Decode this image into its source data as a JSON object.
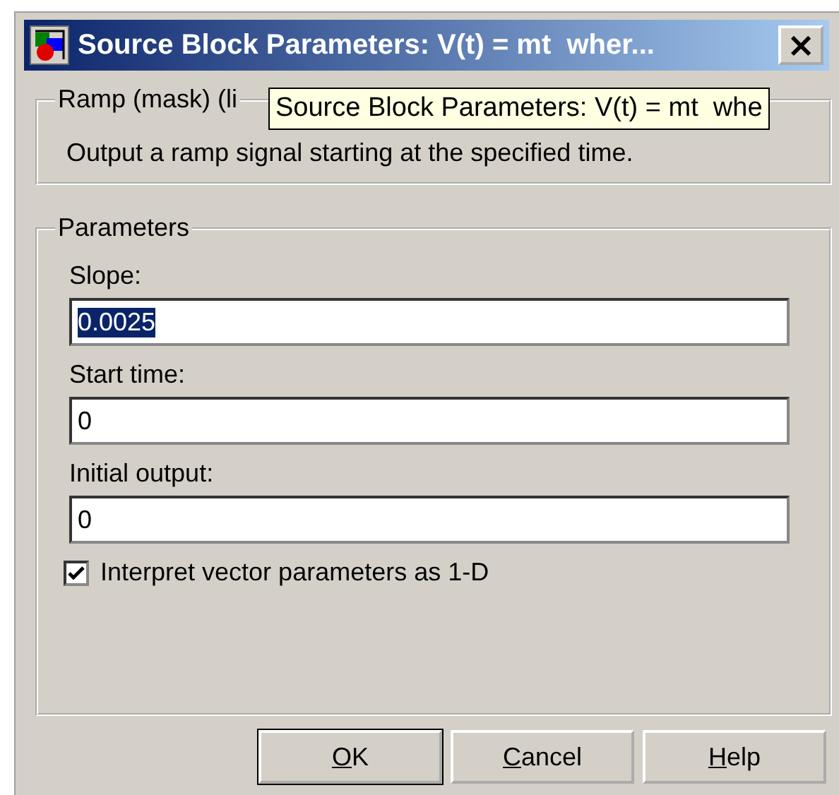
{
  "window": {
    "title": "Source Block Parameters: V(t) = mt  wher...",
    "close_button": "×"
  },
  "tooltip": "Source Block Parameters: V(t) = mt  whe",
  "description_group": {
    "title": "Ramp (mask) (li",
    "text": "Output a ramp signal starting at the specified time."
  },
  "parameters": {
    "title": "Parameters",
    "fields": [
      {
        "label": "Slope:",
        "value": "0.0025",
        "selected": true
      },
      {
        "label": "Start time:",
        "value": "0",
        "selected": false
      },
      {
        "label": "Initial output:",
        "value": "0",
        "selected": false
      }
    ],
    "checkbox": {
      "label": "Interpret vector parameters as 1-D",
      "checked": true
    }
  },
  "buttons": [
    {
      "label": "OK",
      "default": true
    },
    {
      "label": "Cancel",
      "default": false
    },
    {
      "label": "Help",
      "default": false
    }
  ]
}
